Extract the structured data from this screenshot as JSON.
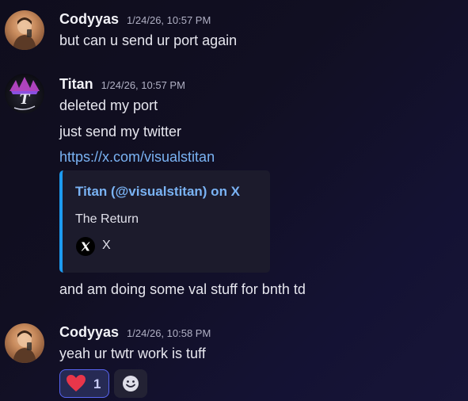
{
  "messages": [
    {
      "author": "Codyyas",
      "timestamp": "1/24/26, 10:57 PM",
      "lines": [
        "but can u send ur port again"
      ]
    },
    {
      "author": "Titan",
      "timestamp": "1/24/26, 10:57 PM",
      "lines": [
        "deleted my port",
        "just send my twitter"
      ],
      "link": "https://x.com/visualstitan",
      "embed": {
        "title": "Titan (@visualstitan) on X",
        "description": "The Return",
        "footer": "X",
        "accent_color": "#1d9bf0"
      },
      "after_embed": "and am doing some val stuff for bnth td"
    },
    {
      "author": "Codyyas",
      "timestamp": "1/24/26, 10:58 PM",
      "lines": [
        "yeah ur twtr work is tuff"
      ],
      "reactions": [
        {
          "emoji": "heart-icon",
          "count": "1",
          "color": "#e8364a"
        }
      ]
    }
  ],
  "colors": {
    "link": "#7ab3f4",
    "reaction_border": "#5865f2"
  },
  "icons": {
    "add_reaction": "smiley-icon",
    "embed_footer": "x-logo-icon"
  }
}
